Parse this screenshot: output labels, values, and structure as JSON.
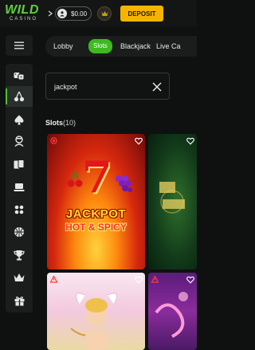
{
  "header": {
    "logo_main": "WILD",
    "logo_sub": "CASINO",
    "balance": "$0.00",
    "deposit_label": "DEPOSIT"
  },
  "tabs": [
    {
      "label": "Lobby"
    },
    {
      "label": "Slots",
      "active": true
    },
    {
      "label": "Blackjack"
    },
    {
      "label": "Live Ca"
    }
  ],
  "search": {
    "value": "jackpot"
  },
  "section": {
    "title": "Slots",
    "count": "(10)"
  },
  "games": [
    {
      "title_line1": "JACKPOT",
      "title_line2": "HOT & SPICY"
    }
  ],
  "colors": {
    "accent_green": "#3cba1e",
    "deposit_yellow": "#f6b400",
    "background": "#0f1110"
  }
}
